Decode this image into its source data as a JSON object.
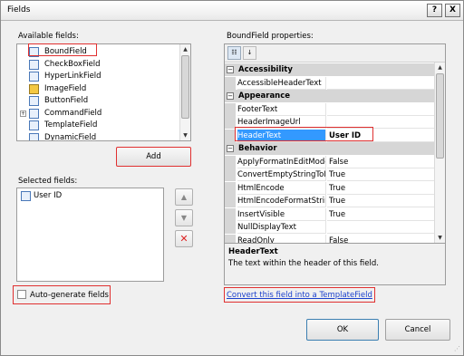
{
  "window": {
    "title": "Fields",
    "help_glyph": "?",
    "close_glyph": "X"
  },
  "available": {
    "label": "Available fields:",
    "items": [
      {
        "label": "BoundField",
        "icon": "bound-field-icon"
      },
      {
        "label": "CheckBoxField",
        "icon": "checkbox-field-icon"
      },
      {
        "label": "HyperLinkField",
        "icon": "hyperlink-field-icon"
      },
      {
        "label": "ImageField",
        "icon": "image-field-icon"
      },
      {
        "label": "ButtonField",
        "icon": "button-field-icon"
      },
      {
        "label": "CommandField",
        "icon": "command-field-icon",
        "expander": "+"
      },
      {
        "label": "TemplateField",
        "icon": "template-field-icon"
      },
      {
        "label": "DynamicField",
        "icon": "dynamic-field-icon"
      }
    ],
    "add_label": "Add"
  },
  "selected": {
    "label": "Selected fields:",
    "items": [
      {
        "label": "User ID"
      }
    ],
    "move_up": "▲",
    "move_down": "▼",
    "delete": "✕"
  },
  "autogenerate": {
    "label": "Auto-generate fields",
    "checked": false
  },
  "properties": {
    "label": "BoundField properties:",
    "categories": [
      {
        "name": "Accessibility",
        "toggle": "−",
        "props": [
          {
            "name": "AccessibleHeaderText",
            "value": ""
          }
        ]
      },
      {
        "name": "Appearance",
        "toggle": "−",
        "props": [
          {
            "name": "FooterText",
            "value": ""
          },
          {
            "name": "HeaderImageUrl",
            "value": ""
          },
          {
            "name": "HeaderText",
            "value": "User ID"
          }
        ]
      },
      {
        "name": "Behavior",
        "toggle": "−",
        "props": [
          {
            "name": "ApplyFormatInEditMode",
            "value": "False"
          },
          {
            "name": "ConvertEmptyStringToNull",
            "value": "True"
          },
          {
            "name": "HtmlEncode",
            "value": "True"
          },
          {
            "name": "HtmlEncodeFormatString",
            "value": "True"
          },
          {
            "name": "InsertVisible",
            "value": "True"
          },
          {
            "name": "NullDisplayText",
            "value": ""
          },
          {
            "name": "ReadOnly",
            "value": "False"
          }
        ]
      }
    ],
    "description_title": "HeaderText",
    "description_text": "The text within the header of this field."
  },
  "convert_link": "Convert this field into a TemplateField",
  "ok_label": "OK",
  "cancel_label": "Cancel"
}
